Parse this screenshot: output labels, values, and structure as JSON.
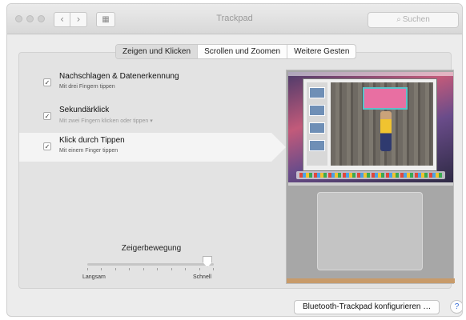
{
  "window": {
    "title": "Trackpad",
    "search_placeholder": "Suchen",
    "back_glyph": "‹",
    "forward_glyph": "›",
    "grid_glyph": "▦",
    "search_glyph": "⌕"
  },
  "tabs": [
    {
      "label": "Zeigen und Klicken",
      "active": true
    },
    {
      "label": "Scrollen und Zoomen",
      "active": false
    },
    {
      "label": "Weitere Gesten",
      "active": false
    }
  ],
  "options": [
    {
      "label": "Nachschlagen & Datenerkennung",
      "sub": "Mit drei Fingern tippen",
      "checked": true,
      "check_glyph": "✓"
    },
    {
      "label": "Sekundärklick",
      "sub": "Mit zwei Fingern klicken oder tippen ▾",
      "checked": true,
      "check_glyph": "✓"
    },
    {
      "label": "Klick durch Tippen",
      "sub": "Mit einem Finger tippen",
      "checked": true,
      "check_glyph": "✓"
    }
  ],
  "tracking": {
    "title": "Zeigerbewegung",
    "min_label": "Langsam",
    "max_label": "Schnell",
    "value": 0.95,
    "tick_count": 10
  },
  "footer": {
    "config_button": "Bluetooth-Trackpad konfigurieren …",
    "help_glyph": "?"
  },
  "colors": {
    "window_bg": "#ececec",
    "panel_bg": "#e3e3e3",
    "selected_row": "#f4f4f4",
    "help_accent": "#3a6fd8"
  },
  "icons": [
    "back-icon",
    "forward-icon",
    "grid-icon",
    "search-icon",
    "checkmark-icon",
    "help-icon"
  ]
}
